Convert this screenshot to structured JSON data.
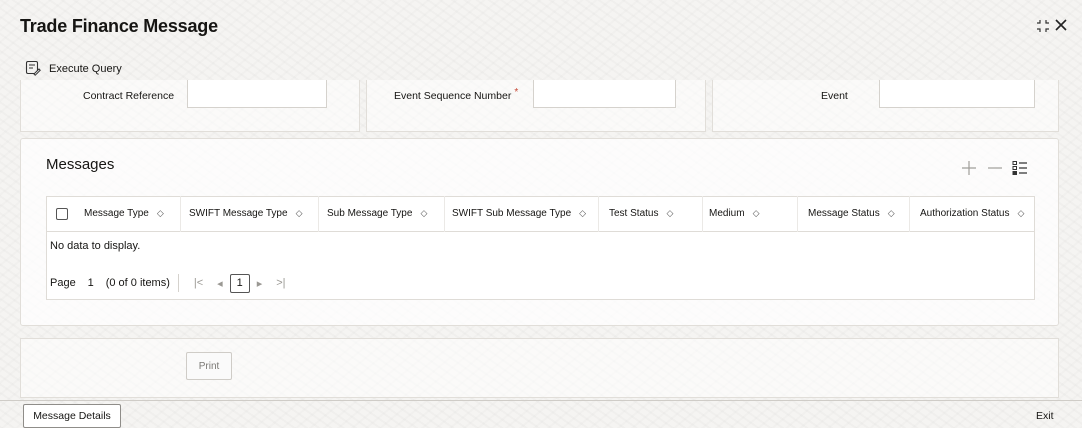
{
  "window": {
    "title": "Trade Finance Message"
  },
  "toolbar": {
    "execute_query_label": "Execute Query"
  },
  "filters": {
    "contract_reference_label": "Contract Reference",
    "contract_reference_value": "",
    "event_sequence_label": "Event Sequence Number",
    "event_sequence_required": "*",
    "event_sequence_value": "",
    "event_label": "Event",
    "event_value": ""
  },
  "messages": {
    "title": "Messages",
    "columns": [
      "Message Type",
      "SWIFT Message Type",
      "Sub Message Type",
      "SWIFT Sub Message Type",
      "Test Status",
      "Medium",
      "Message Status",
      "Authorization Status"
    ],
    "rows": [],
    "empty_text": "No data to display.",
    "pager": {
      "page_label": "Page",
      "page_value": "1",
      "items_text": "(0 of 0 items)",
      "current_page": "1"
    }
  },
  "actions": {
    "print_label": "Print",
    "message_details_label": "Message Details",
    "exit_label": "Exit"
  },
  "colors": {
    "required": "#c74634",
    "text": "#161513",
    "muted": "#9a9893"
  }
}
